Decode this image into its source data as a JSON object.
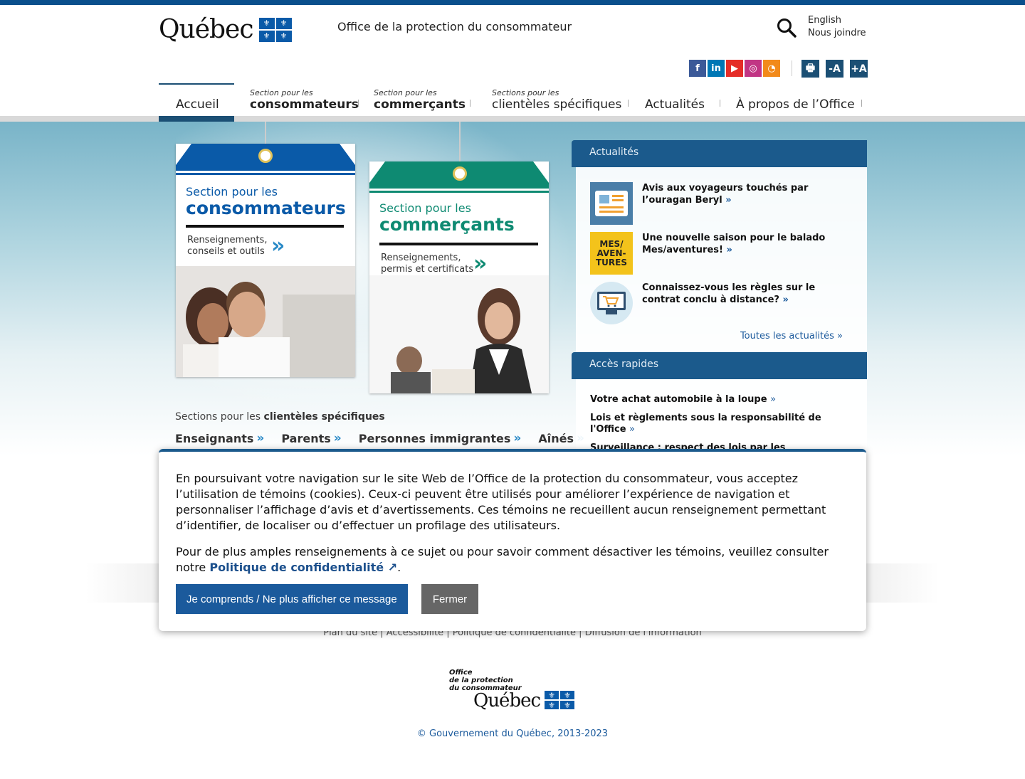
{
  "header": {
    "logo_text": "Québec",
    "org_name": "Office de la protection du consommateur",
    "lang_link": "English",
    "contact_link": "Nous joindre",
    "social": [
      {
        "icon": "facebook-icon",
        "glyph": "f",
        "color": "#3b5998"
      },
      {
        "icon": "linkedin-icon",
        "glyph": "in",
        "color": "#0077b5"
      },
      {
        "icon": "youtube-icon",
        "glyph": "▶",
        "color": "#e52d27"
      },
      {
        "icon": "instagram-icon",
        "glyph": "◎",
        "color": "#c13584"
      },
      {
        "icon": "rss-icon",
        "glyph": "◔",
        "color": "#f28a1a"
      }
    ],
    "tools": {
      "print": "🖶",
      "decrease": "-A",
      "increase": "+A"
    }
  },
  "nav": {
    "home": "Accueil",
    "consumers_small": "Section pour les",
    "consumers_big": "consommateurs",
    "merchants_small": "Section pour les",
    "merchants_big": "commerçants",
    "clients_small": "Sections pour les",
    "clients_big": "clientèles spécifiques",
    "news": "Actualités",
    "about": "À propos de l’Office"
  },
  "cards": {
    "consumers": {
      "title1": "Section pour les",
      "title2": "consommateurs",
      "desc": "Renseignements, conseils et outils",
      "color": "#0a5aa8"
    },
    "merchants": {
      "title1": "Section pour les",
      "title2": "commerçants",
      "desc": "Renseignements, permis et certificats",
      "color": "#0e8a72"
    }
  },
  "specific": {
    "heading_prefix": "Sections pour les ",
    "heading_bold": "clientèles spécifiques",
    "links": [
      "Enseignants",
      "Parents",
      "Personnes immigrantes",
      "Aînés"
    ],
    "chevron": "»"
  },
  "sidebar": {
    "news_title": "Actualités",
    "news": [
      {
        "text": "Avis aux voyageurs touchés par l’ouragan Beryl",
        "icon": "newspaper-icon"
      },
      {
        "text": "Une nouvelle saison pour le balado Mes/aventures!",
        "icon": "podcast-icon",
        "thumb_text": "MES/ AVEN- TURES"
      },
      {
        "text": "Connaissez-vous les règles sur le contrat conclu à distance?",
        "icon": "online-shopping-icon"
      }
    ],
    "all_news": "Toutes les actualités »",
    "quick_title": "Accès rapides",
    "quick": [
      "Votre achat automobile à la loupe",
      "Lois et règlements sous la responsabilité de l'Office",
      "Surveillance : respect des lois par les"
    ],
    "arrow": "»"
  },
  "footer": {
    "links": "Plan du site | Accessibilité | Politique de confidentialité | Diffusion de l'information",
    "logo_line1": "Office",
    "logo_line2": "de la protection",
    "logo_line3": "du consommateur",
    "logo_word": "Québec",
    "copyright": "© Gouvernement du Québec, 2013-2023"
  },
  "cookie": {
    "text1": "En poursuivant votre navigation sur le site Web de l’Office de la protection du consommateur, vous acceptez l’utilisation de témoins (cookies). Ceux-ci peuvent être utilisés pour améliorer l’expérience de navigation et personnaliser l’affichage d’avis et d’avertissements. Ces témoins ne recueillent aucun renseignement permettant d’identifier, de localiser ou d’effectuer un profilage des utilisateurs.",
    "text2_prefix": "Pour de plus amples renseignements à ce sujet ou pour savoir comment désactiver les témoins, veuillez consulter notre ",
    "policy_link": "Politique de confidentialité",
    "external_icon": "↗",
    "text2_suffix": ".",
    "accept_button": "Je comprends / Ne plus afficher ce message",
    "close_button": "Fermer"
  }
}
